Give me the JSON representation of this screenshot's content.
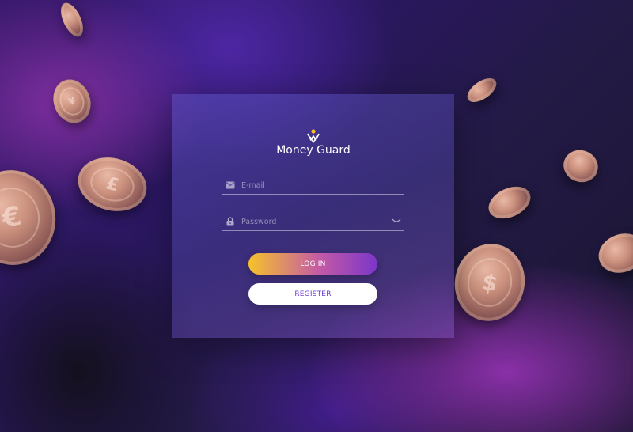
{
  "brand": {
    "title": "Money Guard",
    "logo_icon": "money-guard-logo-icon",
    "logo_colors": [
      "#f6c22b",
      "#ffffff"
    ]
  },
  "form": {
    "email": {
      "placeholder": "E-mail",
      "value": "",
      "icon": "envelope-icon"
    },
    "password": {
      "placeholder": "Password",
      "value": "",
      "icon": "lock-icon",
      "toggle_icon": "eye-closed-icon"
    },
    "login_label": "LOG IN",
    "register_label": "REGISTER"
  },
  "colors": {
    "login_gradient": [
      "#f6c22b",
      "#c45aa6",
      "#7a36c9"
    ],
    "register_text": "#6c3bd1",
    "background_primary": "#2a1760"
  },
  "decor": {
    "coin_icon": "coin-icon",
    "coin_symbols": [
      "€",
      "£",
      "$",
      "¥"
    ]
  }
}
